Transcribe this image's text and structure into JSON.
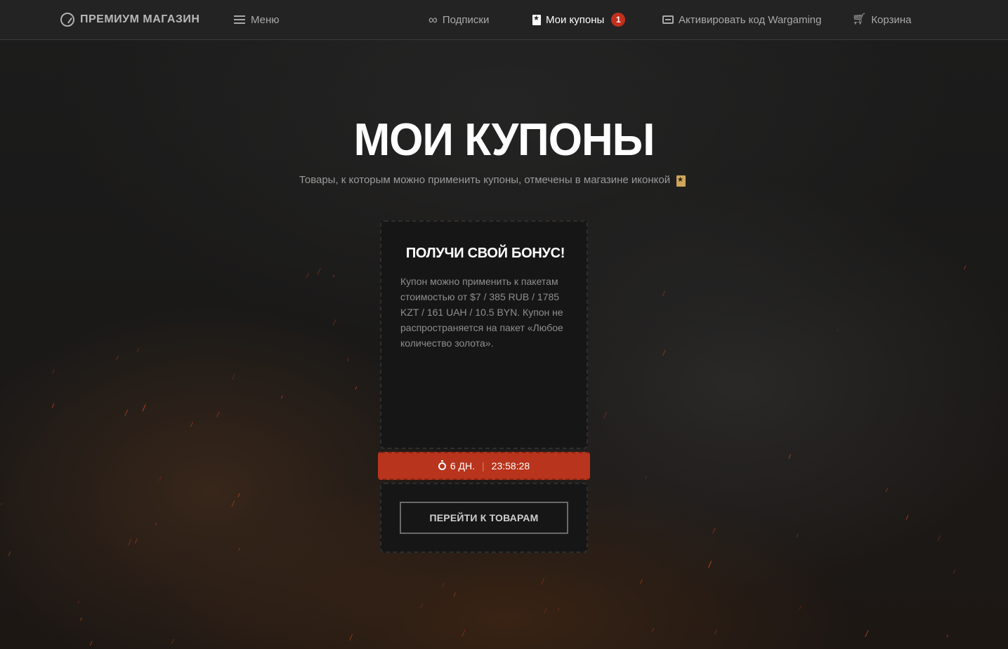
{
  "header": {
    "brand": "ПРЕМИУМ МАГАЗИН",
    "menu_label": "Меню",
    "nav": {
      "subscriptions": "Подписки",
      "coupons": "Мои купоны",
      "coupons_badge": "1",
      "activate": "Активировать код Wargaming",
      "cart": "Корзина"
    }
  },
  "main": {
    "title": "МОИ КУПОНЫ",
    "subtitle": "Товары, к которым можно применить купоны, отмечены в магазине иконкой"
  },
  "coupon": {
    "title": "ПОЛУЧИ СВОЙ БОНУС!",
    "description": "Купон можно применить к пакетам стоимостью от $7 / 385 RUB / 1785 KZT / 161 UAH / 10.5 BYN. Купон не распространяется на пакет «Любое количество золота».",
    "timer_days": "6 ДН.",
    "timer_separator": "|",
    "timer_time": "23:58:28",
    "button_label": "ПЕРЕЙТИ К ТОВАРАМ"
  },
  "colors": {
    "accent": "#b8341c",
    "badge": "#c0301d",
    "coupon_icon": "#cfa55a"
  },
  "icons": {
    "brand": "premium-logo-icon",
    "menu": "hamburger-icon",
    "subscriptions": "infinity-icon",
    "coupons": "coupon-icon",
    "activate": "card-icon",
    "cart": "cart-icon",
    "timer": "stopwatch-icon"
  }
}
